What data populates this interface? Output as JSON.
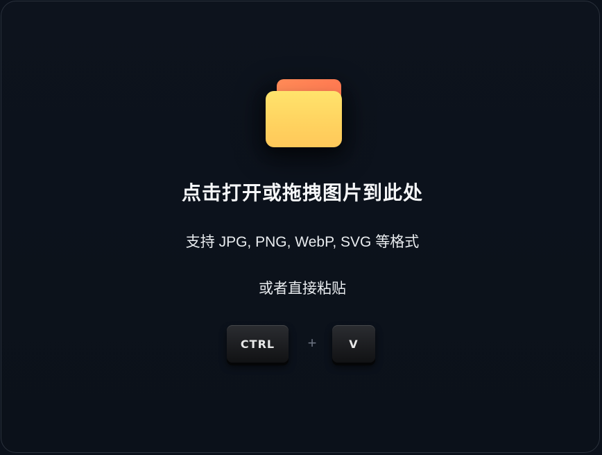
{
  "dropzone": {
    "icon": "folder-icon",
    "title": "点击打开或拖拽图片到此处",
    "subtitle": "支持 JPG, PNG, WebP, SVG 等格式",
    "paste_hint": "或者直接粘贴",
    "shortcut": {
      "keys": [
        "CTRL",
        "V"
      ],
      "separator": "+"
    }
  },
  "colors": {
    "background": "#0b111b",
    "folder_tab": "#ff7f54",
    "folder_body": "#ffd860",
    "text": "#f5f6f8"
  }
}
